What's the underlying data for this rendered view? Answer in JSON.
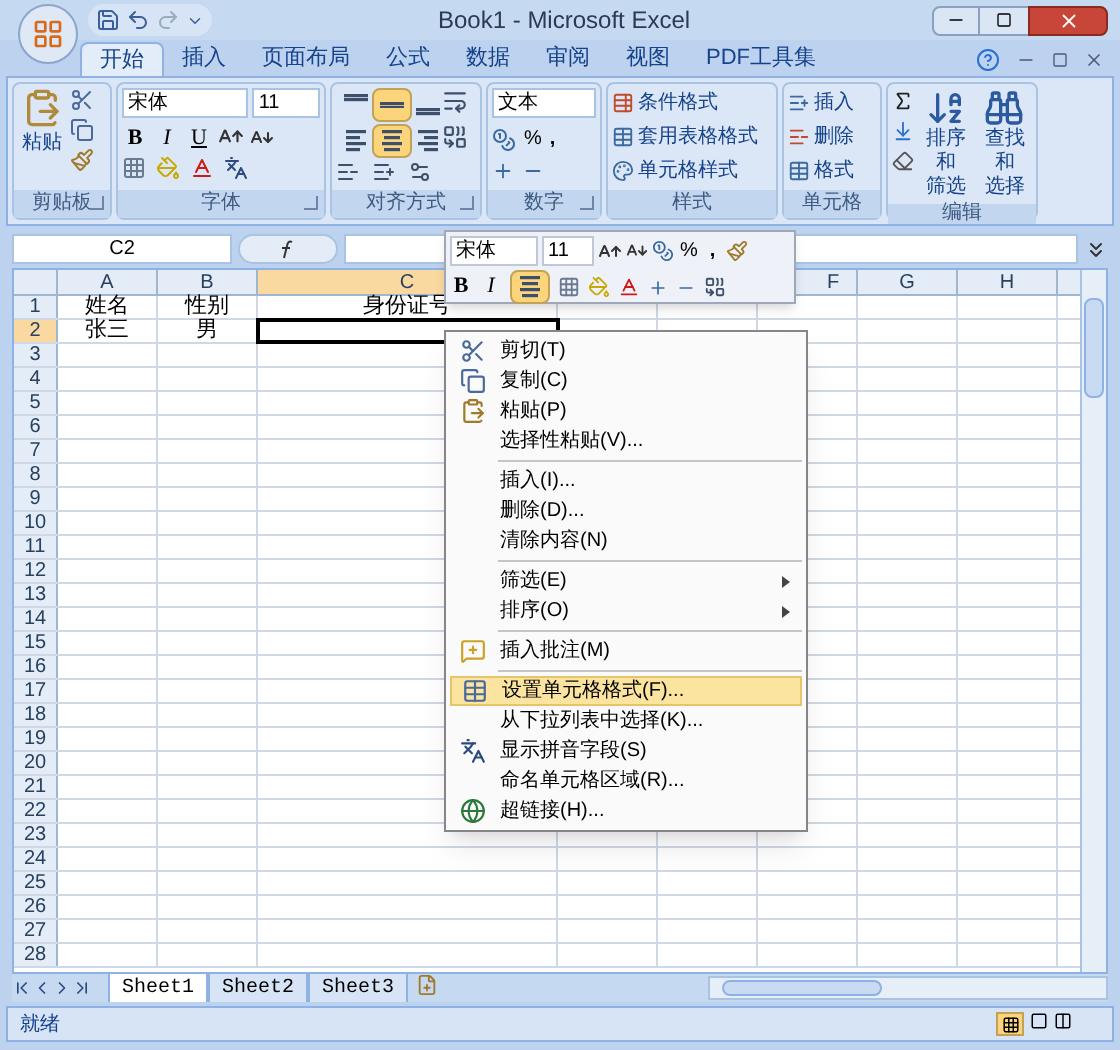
{
  "window": {
    "title": "Book1 - Microsoft Excel"
  },
  "ribbon_tabs": [
    {
      "label": "开始",
      "selected": true
    },
    {
      "label": "插入",
      "selected": false
    },
    {
      "label": "页面布局",
      "selected": false
    },
    {
      "label": "公式",
      "selected": false
    },
    {
      "label": "数据",
      "selected": false
    },
    {
      "label": "审阅",
      "selected": false
    },
    {
      "label": "视图",
      "selected": false
    },
    {
      "label": "PDF工具集",
      "selected": false
    }
  ],
  "clipboard": {
    "paste": "粘贴",
    "label": "剪贴板"
  },
  "font": {
    "name": "宋体",
    "size": "11",
    "bold": "B",
    "italic": "I",
    "underline": "U",
    "label": "字体"
  },
  "alignment": {
    "buttons": [
      {
        "kind": "top",
        "selected": false
      },
      {
        "kind": "middle",
        "selected": true
      },
      {
        "kind": "bottom",
        "selected": false
      },
      {
        "kind": "left",
        "selected": false
      },
      {
        "kind": "center",
        "selected": true
      },
      {
        "kind": "right",
        "selected": false
      }
    ],
    "label": "对齐方式"
  },
  "number": {
    "format": "文本",
    "percent": "%",
    "comma": ",",
    "label": "数字"
  },
  "styles": {
    "items": [
      "条件格式",
      "套用表格格式",
      "单元格样式"
    ],
    "label": "样式"
  },
  "cells": {
    "items": [
      "插入",
      "删除",
      "格式"
    ],
    "label": "单元格"
  },
  "editing": {
    "sort": [
      "排序和",
      "筛选"
    ],
    "find": [
      "查找和",
      "选择"
    ],
    "label": "编辑"
  },
  "formula_bar": {
    "name_box": "C2"
  },
  "sheet": {
    "columns": [
      {
        "label": "A",
        "selected": false
      },
      {
        "label": "B",
        "selected": false
      },
      {
        "label": "C",
        "selected": true
      },
      {
        "label": "F",
        "selected": false
      },
      {
        "label": "G",
        "selected": false
      },
      {
        "label": "H",
        "selected": false
      }
    ],
    "rows": [
      {
        "number": "1",
        "selected": false,
        "cells": [
          "姓名",
          "性别",
          "身份证号"
        ]
      },
      {
        "number": "2",
        "selected": true,
        "cells": [
          "张三",
          "男"
        ]
      },
      {
        "number": "3",
        "selected": false
      },
      {
        "number": "4",
        "selected": false
      },
      {
        "number": "5",
        "selected": false
      },
      {
        "number": "6",
        "selected": false
      },
      {
        "number": "7",
        "selected": false
      },
      {
        "number": "8",
        "selected": false
      },
      {
        "number": "9",
        "selected": false
      },
      {
        "number": "10",
        "selected": false
      },
      {
        "number": "11",
        "selected": false
      },
      {
        "number": "12",
        "selected": false
      },
      {
        "number": "13",
        "selected": false
      },
      {
        "number": "14",
        "selected": false
      },
      {
        "number": "15",
        "selected": false
      },
      {
        "number": "16",
        "selected": false
      },
      {
        "number": "17",
        "selected": false
      },
      {
        "number": "18",
        "selected": false
      },
      {
        "number": "19",
        "selected": false
      },
      {
        "number": "20",
        "selected": false
      },
      {
        "number": "21",
        "selected": false
      },
      {
        "number": "22",
        "selected": false
      },
      {
        "number": "23",
        "selected": false
      },
      {
        "number": "24",
        "selected": false
      },
      {
        "number": "25",
        "selected": false
      },
      {
        "number": "26",
        "selected": false
      },
      {
        "number": "27",
        "selected": false
      },
      {
        "number": "28",
        "selected": false
      }
    ]
  },
  "mini_toolbar": {
    "font": "宋体",
    "size": "11",
    "percent": "%",
    "comma": ",",
    "bold": "B",
    "italic": "I",
    "center_selected": true
  },
  "context_menu": [
    {
      "label": "剪切(T)",
      "kind": "cut",
      "selected": false
    },
    {
      "label": "复制(C)",
      "kind": "copy",
      "selected": false
    },
    {
      "label": "粘贴(P)",
      "kind": "paste",
      "selected": false
    },
    {
      "label": "选择性粘贴(V)...",
      "selected": false
    },
    {
      "label": "插入(I)...",
      "separator_before": true,
      "selected": false
    },
    {
      "label": "删除(D)...",
      "selected": false
    },
    {
      "label": "清除内容(N)",
      "selected": false
    },
    {
      "label": "筛选(E)",
      "separator_before": true,
      "submenu": true,
      "selected": false
    },
    {
      "label": "排序(O)",
      "submenu": true,
      "selected": false
    },
    {
      "label": "插入批注(M)",
      "kind": "comment",
      "separator_before": true,
      "selected": false
    },
    {
      "label": "设置单元格格式(F)...",
      "kind": "format",
      "separator_before": true,
      "selected": true
    },
    {
      "label": "从下拉列表中选择(K)...",
      "selected": false
    },
    {
      "label": "显示拼音字段(S)",
      "kind": "phonetic",
      "selected": false
    },
    {
      "label": "命名单元格区域(R)...",
      "selected": false
    },
    {
      "label": "超链接(H)...",
      "kind": "link",
      "selected": false
    }
  ],
  "sheet_tabs": [
    {
      "label": "Sheet1",
      "selected": true
    },
    {
      "label": "Sheet2",
      "selected": false
    },
    {
      "label": "Sheet3",
      "selected": false
    }
  ],
  "status_bar": {
    "text": "就绪"
  }
}
